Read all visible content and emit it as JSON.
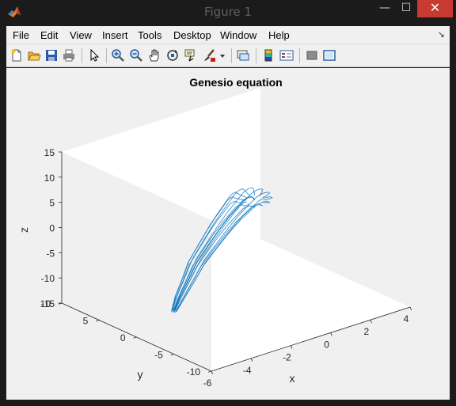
{
  "window": {
    "title": "Figure 1",
    "minimize_glyph": "—",
    "maximize_glyph": "☐",
    "close_glyph": "✕"
  },
  "menu": [
    "File",
    "Edit",
    "View",
    "Insert",
    "Tools",
    "Desktop",
    "Window",
    "Help"
  ],
  "menu_overflow_glyph": "↘",
  "toolbar": [
    "new-figure-icon",
    "open-file-icon",
    "save-icon",
    "print-icon",
    "pointer-icon",
    "zoom-in-icon",
    "zoom-out-icon",
    "pan-hand-icon",
    "rotate-3d-icon",
    "data-cursor-icon",
    "brush-icon",
    "brush-dropdown-icon",
    "link-plot-icon",
    "colorbar-icon",
    "legend-icon",
    "hide-plot-tools-icon",
    "show-plot-tools-icon"
  ],
  "colors": {
    "trajectory": "#0072bd",
    "close_button": "#c83a32",
    "axes_background": "#ffffff",
    "figure_background": "#f0f0f0"
  },
  "chart_data": {
    "type": "line",
    "projection": "3d",
    "title": "Genesio equation",
    "xlabel": "x",
    "ylabel": "y",
    "zlabel": "z",
    "xlim": [
      -6,
      4
    ],
    "ylim": [
      -10,
      10
    ],
    "zlim": [
      -15,
      15
    ],
    "xticks": [
      "-6",
      "-4",
      "-2",
      "0",
      "2",
      "4"
    ],
    "yticks": [
      "-10",
      "-5",
      "0",
      "5",
      "10"
    ],
    "zticks": [
      "-15",
      "-10",
      "-5",
      "0",
      "5",
      "10",
      "15"
    ],
    "grid": false,
    "series": [
      {
        "color": "#0072bd",
        "x": [
          -6.0,
          -5.4,
          -4.5,
          -3.8,
          -2.8,
          -2.0,
          -1.2,
          -0.6,
          0.0,
          0.5,
          1.0,
          1.3,
          1.5,
          1.6
        ],
        "y": [
          -5.0,
          -4.2,
          -3.1,
          -2.2,
          -1.2,
          -0.4,
          0.4,
          1.0,
          1.7,
          2.4,
          3.2,
          3.8,
          4.2,
          4.4
        ],
        "z": [
          -6.5,
          -5.0,
          -3.0,
          -1.5,
          0.2,
          1.5,
          2.5,
          3.0,
          3.3,
          2.8,
          1.8,
          0.8,
          0.0,
          -0.4
        ]
      }
    ]
  }
}
